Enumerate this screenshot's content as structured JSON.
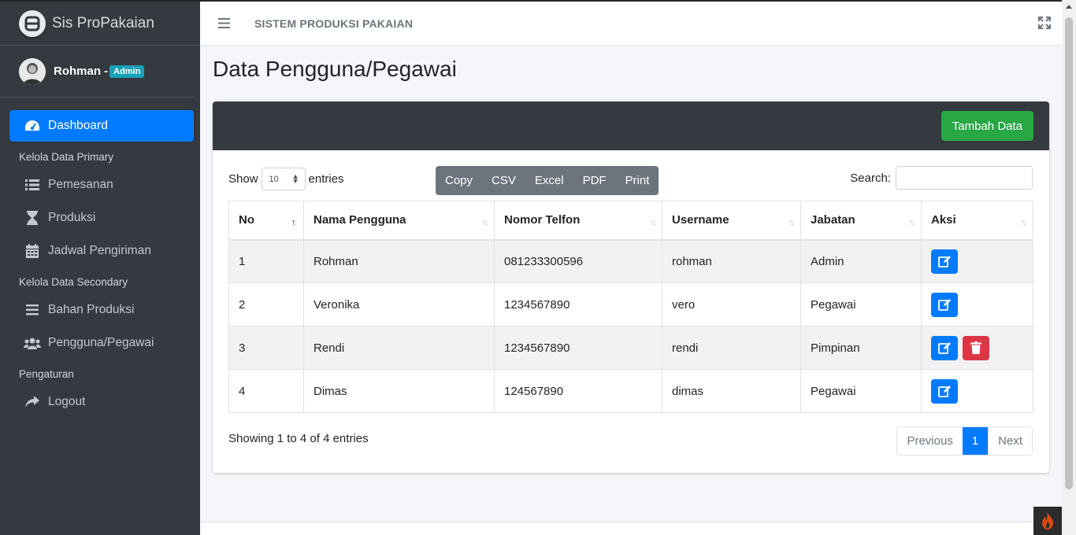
{
  "brand": {
    "name": "Sis ProPakaian"
  },
  "user": {
    "name": "Rohman -",
    "role": "Admin"
  },
  "sidebar": {
    "items": [
      {
        "label": "Dashboard",
        "icon": "tachometer-icon",
        "active": true
      },
      {
        "header": "Kelola Data Primary"
      },
      {
        "label": "Pemesanan",
        "icon": "list-icon"
      },
      {
        "label": "Produksi",
        "icon": "hourglass-icon"
      },
      {
        "label": "Jadwal Pengiriman",
        "icon": "calendar-icon"
      },
      {
        "header": "Kelola Data Secondary"
      },
      {
        "label": "Bahan Produksi",
        "icon": "bars-icon"
      },
      {
        "label": "Pengguna/Pegawai",
        "icon": "users-icon"
      },
      {
        "header": "Pengaturan"
      },
      {
        "label": "Logout",
        "icon": "share-icon"
      }
    ]
  },
  "topnav": {
    "title": "SISTEM PRODUKSI PAKAIAN"
  },
  "page": {
    "title": "Data Pengguna/Pegawai"
  },
  "card": {
    "add_button": "Tambah Data"
  },
  "table_controls": {
    "show_label": "Show",
    "entries_label": "entries",
    "page_size": "10",
    "export_buttons": [
      "Copy",
      "CSV",
      "Excel",
      "PDF",
      "Print"
    ],
    "search_label": "Search:",
    "search_value": ""
  },
  "table": {
    "columns": [
      "No",
      "Nama Pengguna",
      "Nomor Telfon",
      "Username",
      "Jabatan",
      "Aksi"
    ],
    "rows": [
      {
        "no": "1",
        "nama": "Rohman",
        "telp": "081233300596",
        "username": "rohman",
        "jabatan": "Admin",
        "can_delete": false
      },
      {
        "no": "2",
        "nama": "Veronika",
        "telp": "1234567890",
        "username": "vero",
        "jabatan": "Pegawai",
        "can_delete": false
      },
      {
        "no": "3",
        "nama": "Rendi",
        "telp": "1234567890",
        "username": "rendi",
        "jabatan": "Pimpinan",
        "can_delete": true
      },
      {
        "no": "4",
        "nama": "Dimas",
        "telp": "124567890",
        "username": "dimas",
        "jabatan": "Pegawai",
        "can_delete": false
      }
    ]
  },
  "footer": {
    "info": "Showing 1 to 4 of 4 entries",
    "previous": "Previous",
    "current_page": "1",
    "next": "Next"
  },
  "colors": {
    "primary": "#007bff",
    "success": "#28a745",
    "danger": "#dc3545",
    "sidebar": "#343a40",
    "info": "#17a2b8"
  }
}
